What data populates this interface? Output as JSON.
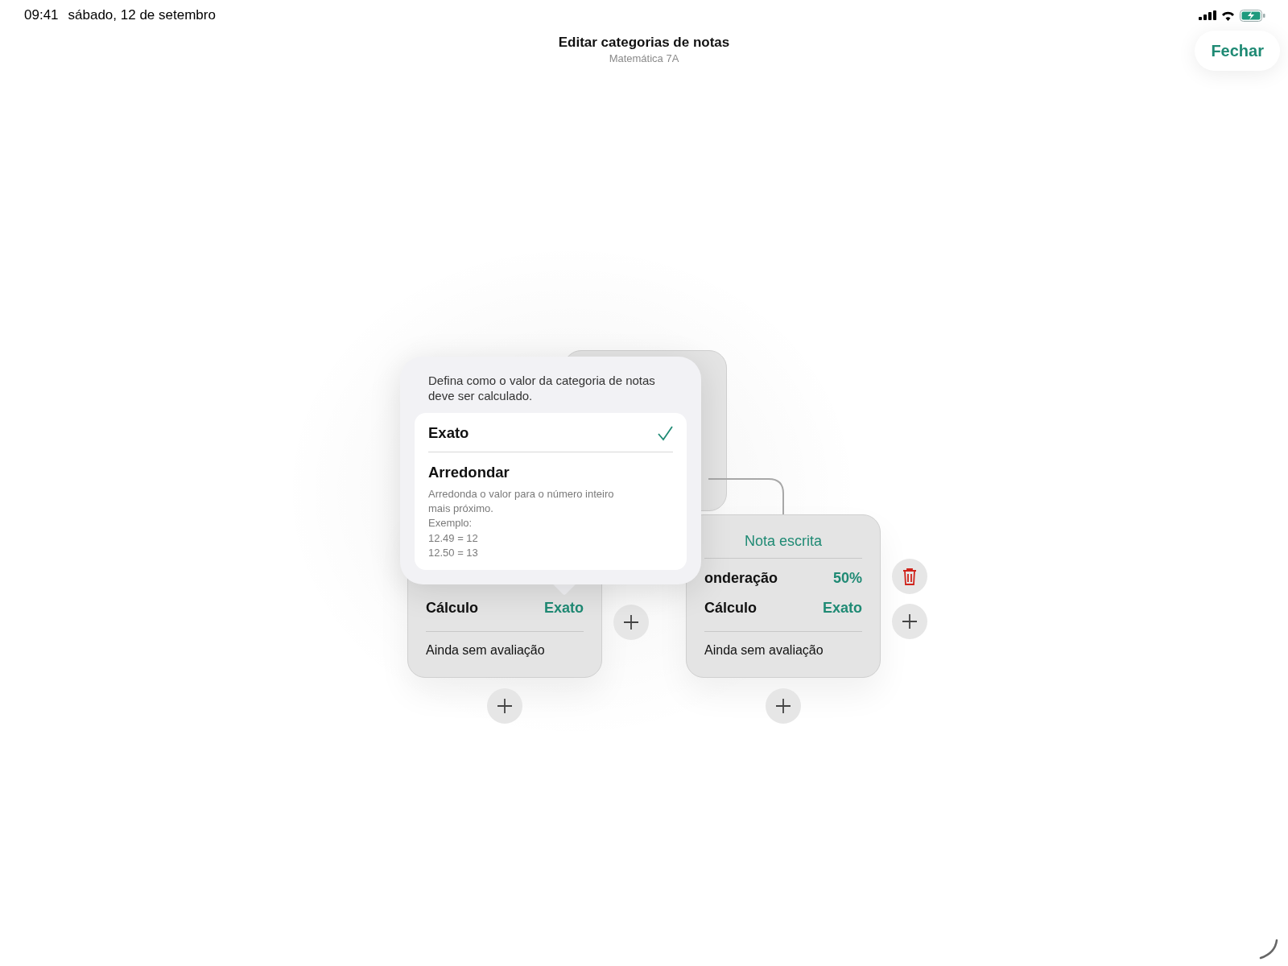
{
  "status_bar": {
    "time": "09:41",
    "date": "sábado, 12 de setembro"
  },
  "header": {
    "title": "Editar categorias de notas",
    "subtitle": "Matemática 7A",
    "close_button": "Fechar"
  },
  "categories": [
    {
      "rows": [
        {
          "label": "Cálculo",
          "value": "Exato"
        }
      ],
      "footer": "Ainda sem avaliação",
      "deletable": false
    },
    {
      "title": "Nota escrita",
      "rows": [
        {
          "label": "onderação",
          "value": "50%"
        },
        {
          "label": "Cálculo",
          "value": "Exato"
        }
      ],
      "footer": "Ainda sem avaliação",
      "deletable": true
    }
  ],
  "popover": {
    "description": "Defina como o valor da categoria de notas deve ser calculado.",
    "options": [
      {
        "label": "Exato",
        "selected": true
      },
      {
        "label": "Arredondar",
        "selected": false,
        "details": "Arredonda o valor para o número inteiro mais próximo.",
        "example_lines": [
          "Exemplo:",
          "12.49 = 12",
          "12.50 = 13"
        ]
      }
    ]
  }
}
